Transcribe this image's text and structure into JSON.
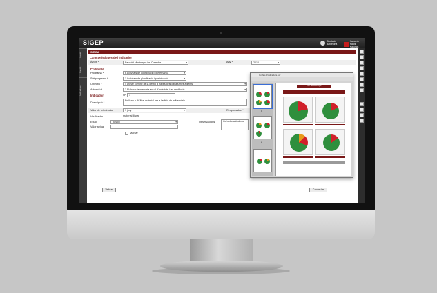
{
  "app": {
    "title": "SIGEP"
  },
  "logos": {
    "diputacio_line1": "Diputació",
    "diputacio_line2": "Barcelona",
    "parcs_line1": "Xarxa de",
    "parcs_line2": "Parcs Naturals"
  },
  "left_tabs": [
    "Ambit",
    "Gestió",
    "Indicadors"
  ],
  "section": {
    "title": "SIRGA"
  },
  "form": {
    "heading": "Característiques de l'indicador",
    "ambit": {
      "label": "Àmbit *",
      "value": "Parc del Montnegre i el Corredor"
    },
    "any": {
      "label": "Any *",
      "value": "2010"
    },
    "programa_group": "Programa",
    "programa": {
      "label": "Programa *",
      "value": "6 Activitats de coordinació i governança"
    },
    "subprograma": {
      "label": "Subprograma *",
      "value": "1 Activitats de planificació i participació"
    },
    "objectiu": {
      "label": "Objectiu *",
      "value": "4 Donar compte de la gestió a través dels canals més adients"
    },
    "actuacio": {
      "label": "Actuació *",
      "value": "3 Elaborar la memòria anual d'activitats i fer-ne difusió"
    },
    "indicador_group": "Indicador",
    "numero": {
      "label": "Nº",
      "value": "1"
    },
    "descripcio": {
      "label": "Descripció *",
      "value": "Es lliura a BCN el material per a l'edició de la Memòria"
    },
    "valor_referencia": {
      "label": "Valor de referència",
      "value": "1 juny"
    },
    "responsable": {
      "label": "Responsable *",
      "value": ""
    },
    "verificador": {
      "label": "Verificador",
      "value": "material lliurat"
    },
    "estat": {
      "label": "Estat",
      "value": "Assolit"
    },
    "observacions": {
      "label": "Observacions",
      "value": "Cal aplicació al mu"
    },
    "valor_actual": {
      "label": "Valor actual",
      "value": ""
    },
    "marcar": {
      "label": "Marcar"
    },
    "validar_button": "Validar",
    "cancelar_button": "Cancel·lar"
  },
  "popup": {
    "title": "Gràfics d'indicadors.pdf",
    "page_title": "Parc del Montnegre",
    "thumb_numbers": [
      "1",
      "2"
    ]
  },
  "colors": {
    "accent": "#7a1818",
    "pie_green": "#2f8f3d",
    "pie_red": "#d0202a",
    "pie_orange": "#e89a1a"
  }
}
